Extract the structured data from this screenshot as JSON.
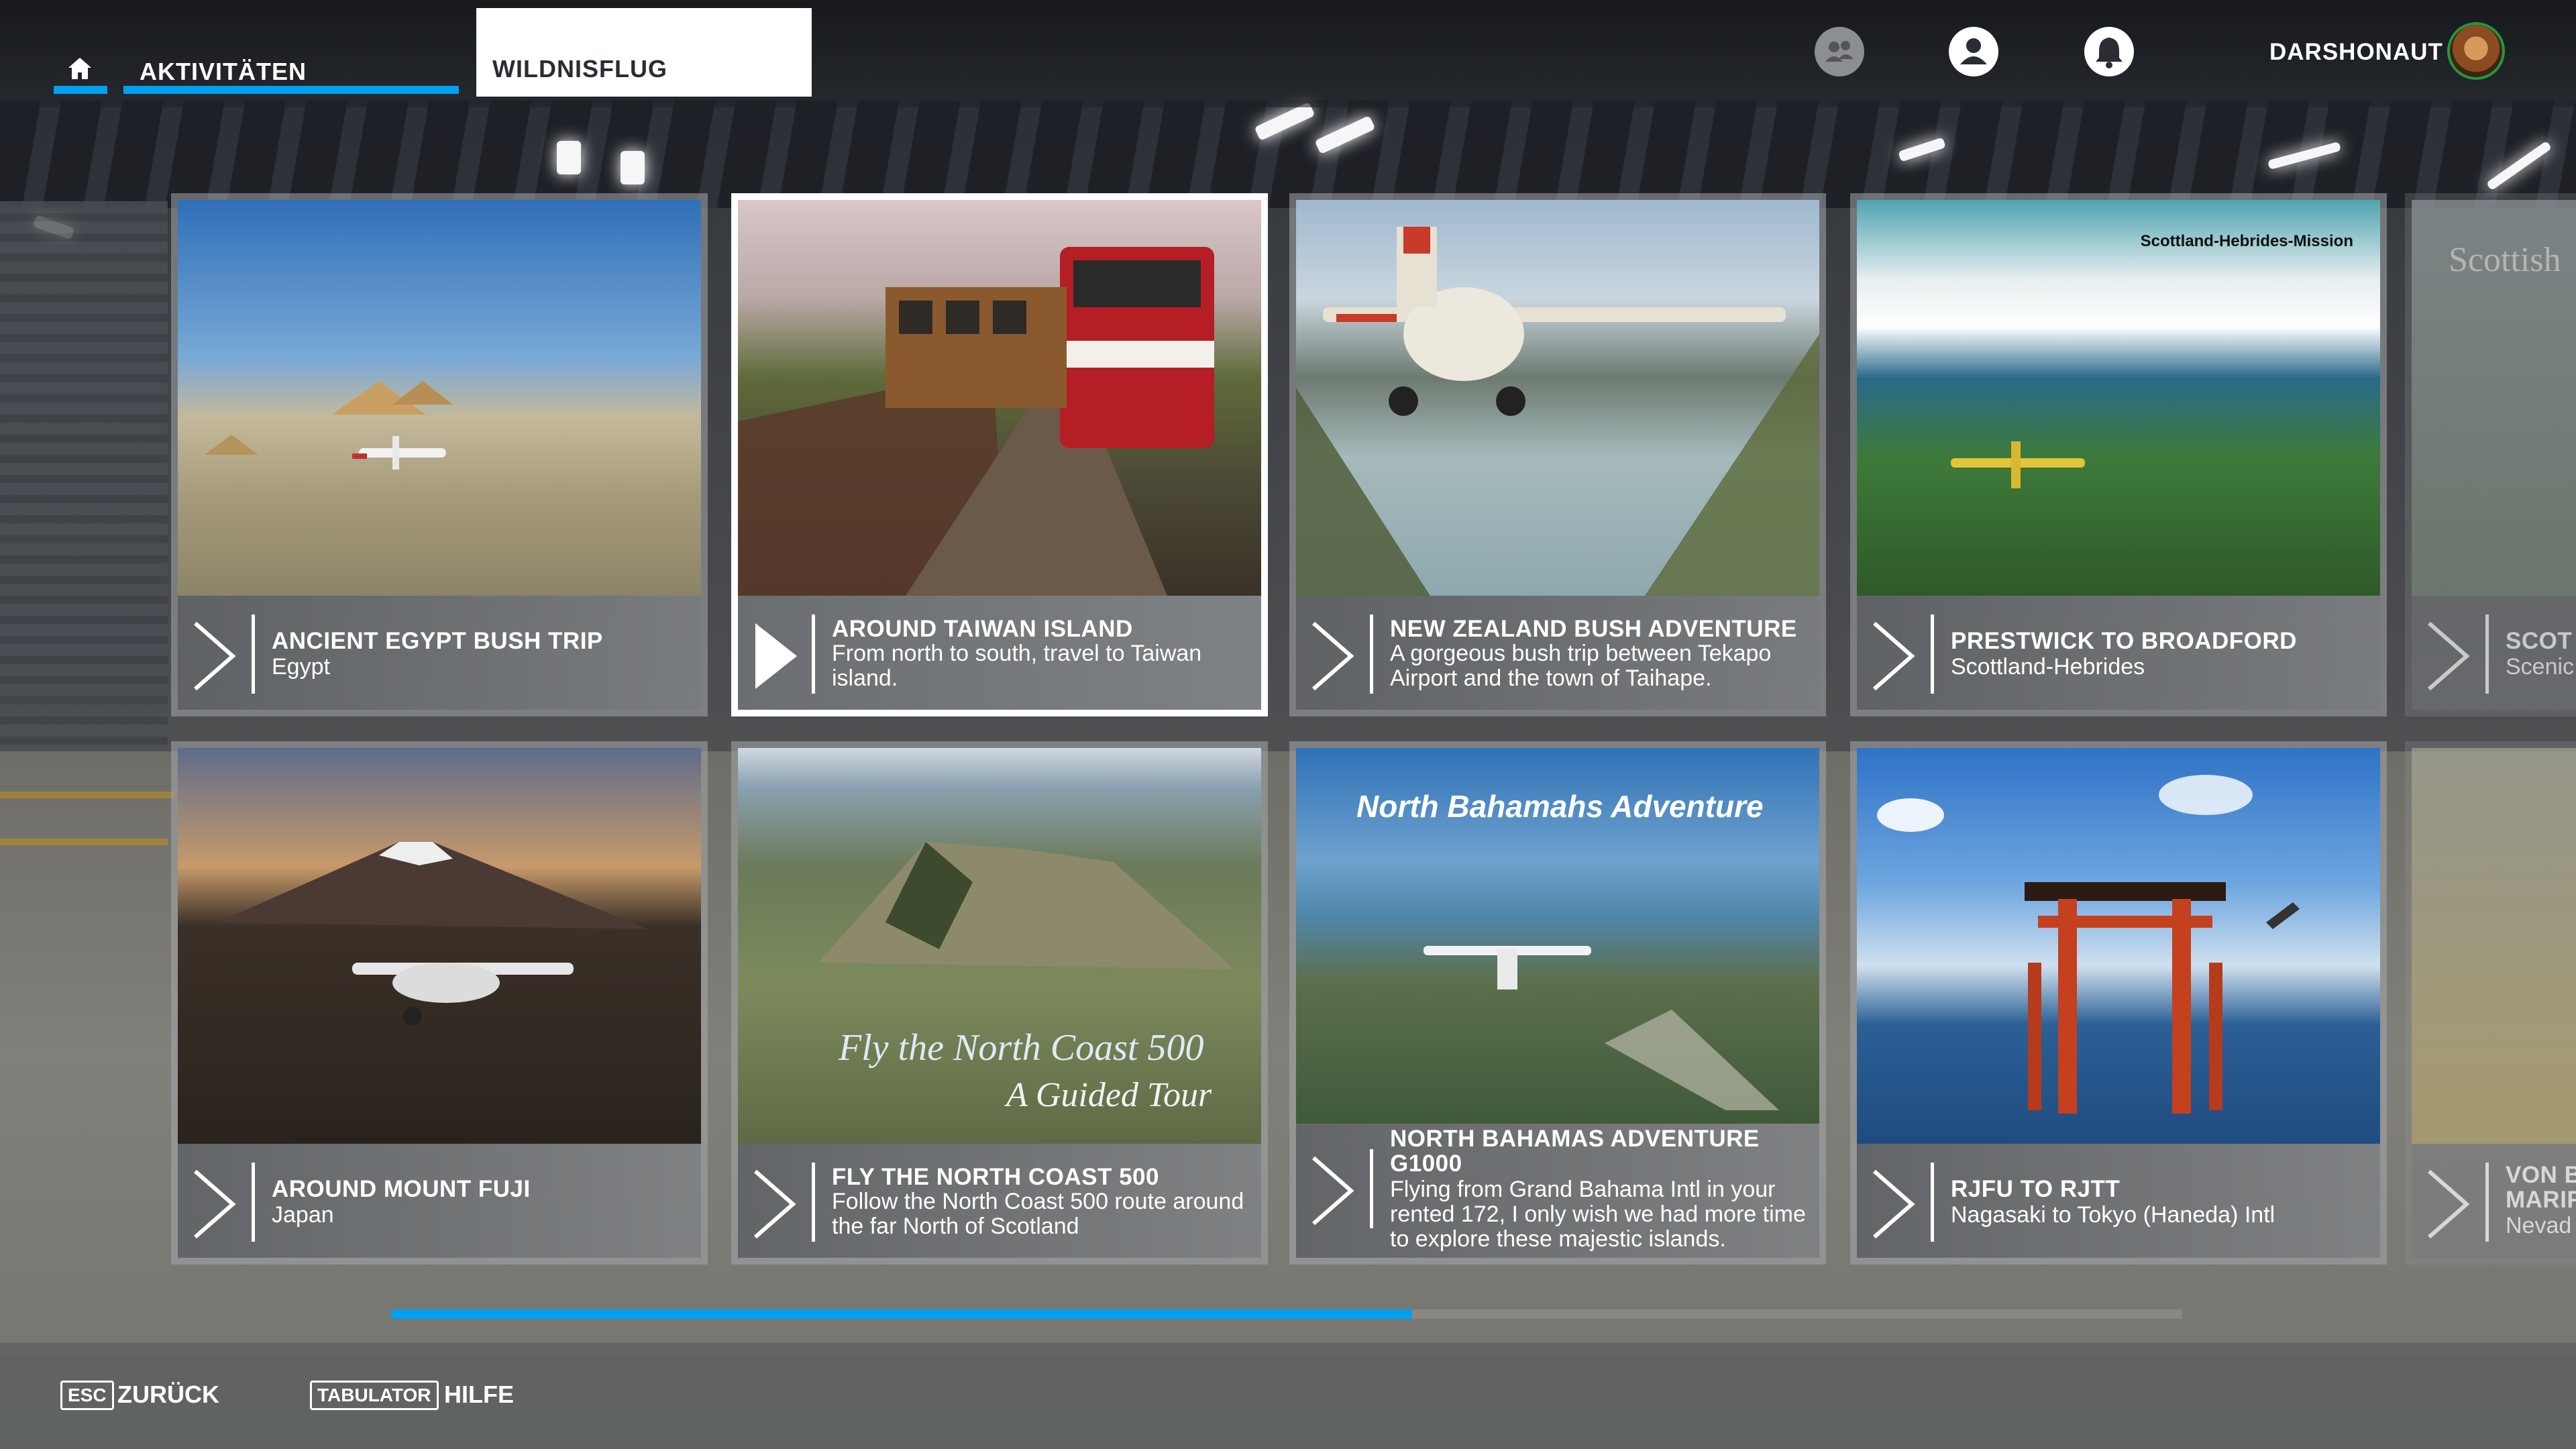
{
  "header": {
    "tab_activities": "AKTIVITÄTEN",
    "tab_wildnisflug": "WILDNISFLUG",
    "username": "DARSHONAUT"
  },
  "cards": [
    {
      "title": "ANCIENT EGYPT BUSH TRIP",
      "subtitle": "Egypt",
      "image_text": ""
    },
    {
      "title": "AROUND TAIWAN ISLAND",
      "subtitle": "From north to south, travel to Taiwan island.",
      "image_text": ""
    },
    {
      "title": "NEW ZEALAND BUSH ADVENTURE",
      "subtitle": "A gorgeous bush trip between Tekapo Airport and the town of Taihape.",
      "image_text": ""
    },
    {
      "title": "PRESTWICK TO BROADFORD",
      "subtitle": "Scottland-Hebrides",
      "image_text": "Scottland-Hebrides-Mission"
    },
    {
      "title": "AROUND MOUNT FUJI",
      "subtitle": "Japan",
      "image_text": ""
    },
    {
      "title": "FLY THE NORTH COAST 500",
      "subtitle": "Follow the North Coast 500 route around the far North of Scotland",
      "image_text": "Fly the North Coast 500",
      "image_text2": "A Guided Tour"
    },
    {
      "title": "NORTH BAHAMAS ADVENTURE G1000",
      "subtitle": "Flying from Grand Bahama Intl in your rented 172, I only wish we had more time to explore these majestic islands.",
      "image_text": "North Bahamahs Adventure"
    },
    {
      "title": "RJFU TO RJTT",
      "subtitle": "Nagasaki to Tokyo (Haneda) Intl",
      "image_text": ""
    }
  ],
  "peek_cards": [
    {
      "title": "SCOT",
      "subtitle": "Scenic",
      "image_text": "Scottish"
    },
    {
      "title": "VON B MARIF",
      "subtitle": "Nevad"
    }
  ],
  "scroll": {
    "position_fraction": 0.57
  },
  "footer": {
    "esc_key": "ESC",
    "esc_label": "ZURÜCK",
    "tab_key": "TABULATOR",
    "tab_label": "HILFE"
  },
  "colors": {
    "accent": "#00a0f0",
    "selected_card": "#ffffff"
  }
}
